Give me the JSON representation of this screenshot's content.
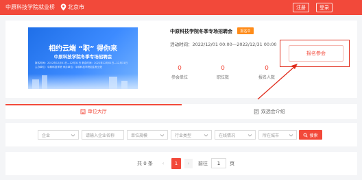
{
  "header": {
    "brand": "中原科技学院就业桥",
    "city": "北京市",
    "register_label": "注册",
    "login_label": "登录"
  },
  "fair": {
    "banner_title": "相约云端 “职” 得你来",
    "banner_subtitle": "中原科技学院冬季专场招聘会",
    "banner_line1": "报名时间：2022年12月01日—12月31日    参会时间：2022年12月01日—12月31日",
    "banner_line2": "主办单位：中原科技学院    承办单位：中原科技学院招生就业处",
    "title": "中原科技学院冬季专场招聘会",
    "status": "报名中",
    "time": "活动时间：2022/12/01 00:00—2022/12/31 00:00",
    "stats": [
      {
        "value": "0",
        "label": "参会单位"
      },
      {
        "value": "0",
        "label": "职位数"
      },
      {
        "value": "0",
        "label": "报名人数"
      }
    ],
    "join_label": "报名参会"
  },
  "tabs": [
    {
      "label": "单位大厅",
      "active": true
    },
    {
      "label": "双选会介绍",
      "active": false
    }
  ],
  "filters": {
    "company_type": "企业",
    "company_name_placeholder": "请输入企业名称",
    "company_scale": "单位规模",
    "industry": "行业类型",
    "location": "在线情况",
    "city": "所在城市",
    "search_label": "搜索"
  },
  "pagination": {
    "total": "共 0 条",
    "prev": "‹",
    "current": "1",
    "next": "›",
    "goto_label": "前往",
    "goto_value": "1",
    "unit": "页"
  },
  "colors": {
    "accent": "#f2493a",
    "badge": "#ff8c1a",
    "banner": "#1f6fe8"
  }
}
